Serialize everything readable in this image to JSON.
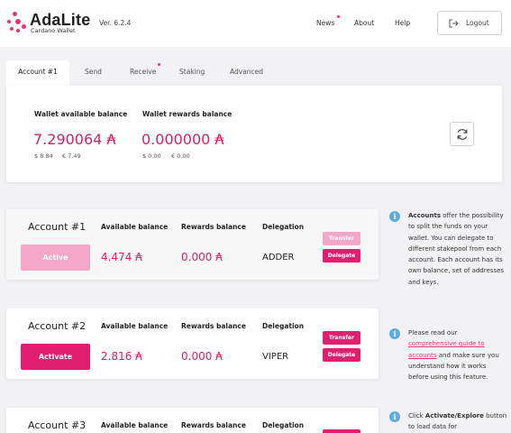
{
  "header": {
    "brand": "AdaLite",
    "brand_sub": "Cardano Wallet",
    "version": "Ver. 6.2.4",
    "nav": [
      "News",
      "About",
      "Help"
    ],
    "logout_label": "Logout",
    "accent_color": "#e8327a"
  },
  "tabs": [
    "Account #1",
    "Send",
    "Receive",
    "Staking",
    "Advanced"
  ],
  "balance": {
    "available_label": "Wallet available balance",
    "available_value": "7.290064 ₳",
    "available_usd": "$ 8.84",
    "available_eur": "€ 7.49",
    "rewards_label": "Wallet rewards balance",
    "rewards_value": "0.000000 ₳",
    "rewards_usd": "$ 0.00",
    "rewards_eur": "€ 0.00"
  },
  "columns": {
    "available": "Available balance",
    "rewards": "Rewards balance",
    "delegation": "Delegation"
  },
  "accounts": [
    {
      "title": "Account #1",
      "button": "Active",
      "available": "4.474 ₳",
      "rewards": "0.000 ₳",
      "delegation": "ADDER",
      "transfer": "Transfer",
      "delegate": "Delegate"
    },
    {
      "title": "Account #2",
      "button": "Activate",
      "available": "2.816 ₳",
      "rewards": "0.000 ₳",
      "delegation": "VIPER",
      "transfer": "Transfer",
      "delegate": "Delegate"
    },
    {
      "title": "Account #3",
      "available_head": "Available balance"
    }
  ],
  "info": {
    "p1_bold": "Accounts",
    "p1_text": " offer the possibility to split the funds on your wallet. You can delegate to different stakepool from each account. Each account has its own balance, set of addresses and keys.",
    "p2_pre": "Please read our ",
    "p2_link": "comprehensive guide to accounts",
    "p2_post": " and make sure you understand how it works before using this feature.",
    "p3_pre": "Click ",
    "p3_bold": "Activate/Explore",
    "p3_post": " button to load data for"
  }
}
